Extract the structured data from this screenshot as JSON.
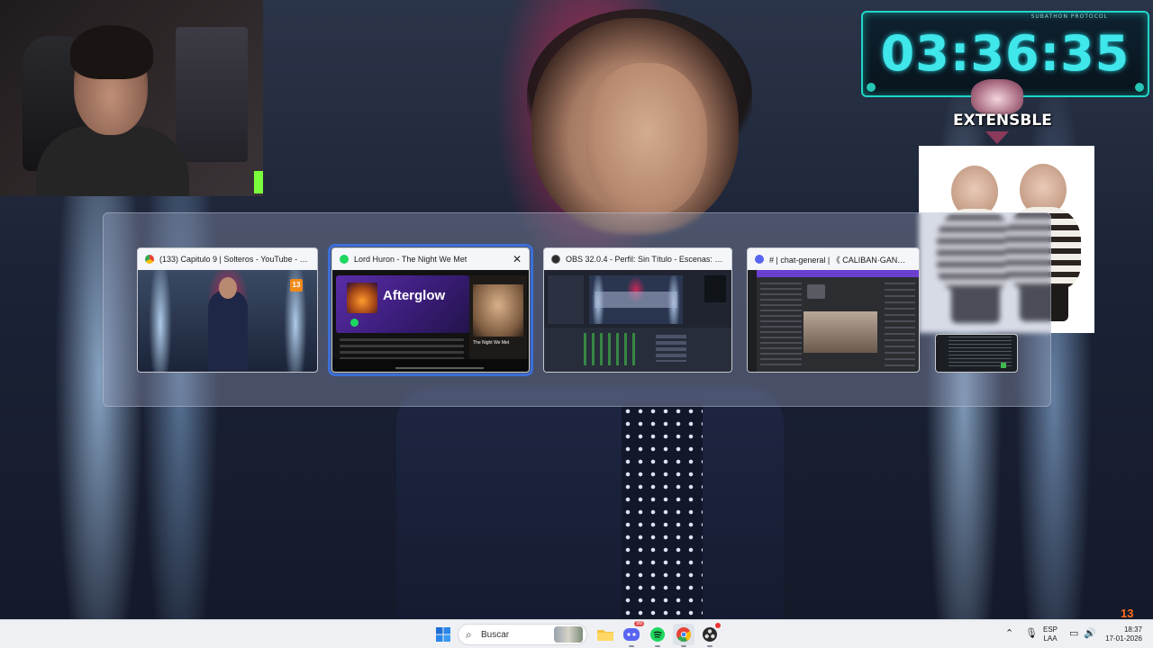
{
  "timer": {
    "label": "SUBATHON PROTOCOL",
    "value": "03:36:35",
    "brand": "EXTENSBLE",
    "accent": "#3fe6ea"
  },
  "switcher": {
    "windows": [
      {
        "title": "(133) Capitulo 9 | Solteros - YouTube - Googl...",
        "app_icon": "chrome-icon",
        "selected": false
      },
      {
        "title": "Lord Huron - The Night We Met",
        "app_icon": "spotify-icon",
        "selected": true,
        "album": "Afterglow",
        "side_caption": "The Night We Met"
      },
      {
        "title": "OBS 32.0.4 - Perfil: Sin Título - Escenas: Sin Título",
        "app_icon": "obs-icon",
        "selected": false
      },
      {
        "title": "# | chat-general | 《 CALIBAN·GANG 》- ...",
        "app_icon": "discord-icon",
        "selected": false
      },
      {
        "title": "",
        "app_icon": "terminal-icon",
        "selected": false
      }
    ],
    "selection_color": "#3b6fd9"
  },
  "taskbar": {
    "search_placeholder": "Buscar",
    "pinned": [
      "start-icon",
      "search-icon",
      "file-explorer-icon",
      "discord-icon",
      "spotify-icon",
      "chrome-icon",
      "obs-icon"
    ],
    "discord_badge": "99",
    "lang": {
      "line1": "ESP",
      "line2": "LAA"
    },
    "clock": {
      "time": "18:37",
      "date": "17-01-2026"
    },
    "tray_icons": [
      "chevron-up-icon",
      "microphone-icon",
      "display-icon",
      "speaker-icon"
    ]
  },
  "overlay": {
    "channel_logo": "13"
  }
}
